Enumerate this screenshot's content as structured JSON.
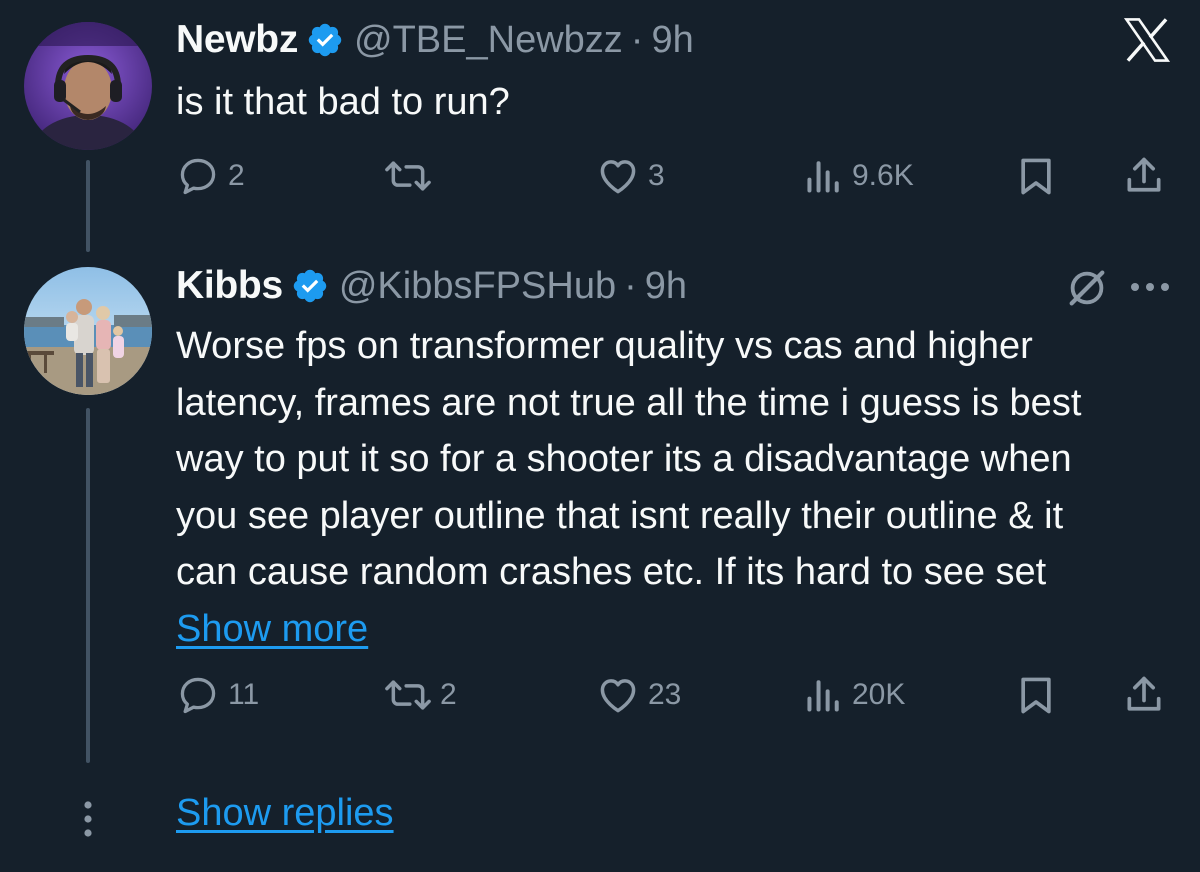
{
  "tweets": [
    {
      "name": "Newbz",
      "handle": "@TBE_Newbzz",
      "separator": "·",
      "time": "9h",
      "text": "is it that bad to run?",
      "replies": "2",
      "reposts": "",
      "likes": "3",
      "views": "9.6K"
    },
    {
      "name": "Kibbs",
      "handle": "@KibbsFPSHub",
      "separator": "·",
      "time": "9h",
      "text": "Worse fps on transformer quality vs cas and higher latency, frames are not true all the time i guess is best way to put it so for a shooter its a disadvantage when you see player outline that isnt really their outline & it can cause random crashes etc. If its hard to see set",
      "show_more": "Show more",
      "replies": "11",
      "reposts": "2",
      "likes": "23",
      "views": "20K"
    }
  ],
  "show_replies": "Show replies",
  "icons": {
    "verified": "verified-badge-icon",
    "close": "x-logo-icon",
    "grok": "grok-icon",
    "more": "more-icon",
    "reply": "reply-icon",
    "repost": "repost-icon",
    "like": "like-icon",
    "views": "views-icon",
    "bookmark": "bookmark-icon",
    "share": "share-icon"
  },
  "colors": {
    "background": "#15202b",
    "text": "#f7f9f9",
    "secondary": "#8b98a5",
    "accent": "#1d9bf0",
    "thread_line": "#425364"
  }
}
